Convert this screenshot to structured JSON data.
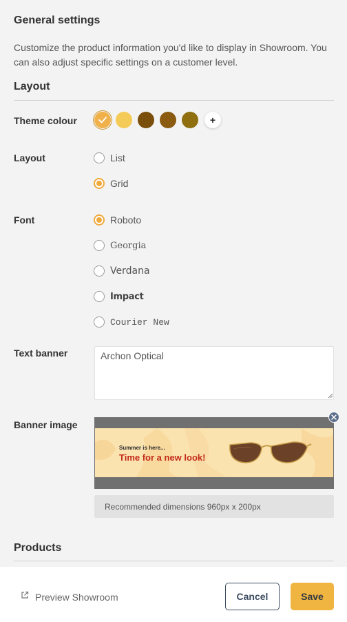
{
  "header": {
    "title": "General settings",
    "description": "Customize the product information you'd like to display in Showroom. You can also adjust specific settings on a customer level."
  },
  "layout_section": {
    "title": "Layout",
    "theme_colour": {
      "label": "Theme colour",
      "swatches": [
        {
          "color": "#f0b14a",
          "selected": true
        },
        {
          "color": "#f5cb58",
          "selected": false
        },
        {
          "color": "#7a4f0c",
          "selected": false
        },
        {
          "color": "#8b5b12",
          "selected": false
        },
        {
          "color": "#8f6f10",
          "selected": false
        }
      ],
      "add_label": "+"
    },
    "layout": {
      "label": "Layout",
      "options": [
        {
          "label": "List",
          "checked": false
        },
        {
          "label": "Grid",
          "checked": true
        }
      ]
    },
    "font": {
      "label": "Font",
      "options": [
        {
          "label": "Roboto",
          "checked": true
        },
        {
          "label": "Georgia",
          "checked": false
        },
        {
          "label": "Verdana",
          "checked": false
        },
        {
          "label": "Impact",
          "checked": false
        },
        {
          "label": "Courier New",
          "checked": false
        }
      ]
    },
    "text_banner": {
      "label": "Text banner",
      "value": "Archon Optical"
    },
    "banner_image": {
      "label": "Banner image",
      "image_small_text": "Summer is here...",
      "image_big_text": "Time for a new look!",
      "hint": "Recommended dimensions 960px x 200px"
    }
  },
  "products_section": {
    "title": "Products"
  },
  "footer": {
    "preview_label": "Preview Showroom",
    "cancel_label": "Cancel",
    "save_label": "Save"
  },
  "colors": {
    "accent": "#f0b540",
    "radio_checked": "#f0a93b",
    "cancel_border": "#3a4a5e",
    "close_badge": "#5b6f8c"
  }
}
